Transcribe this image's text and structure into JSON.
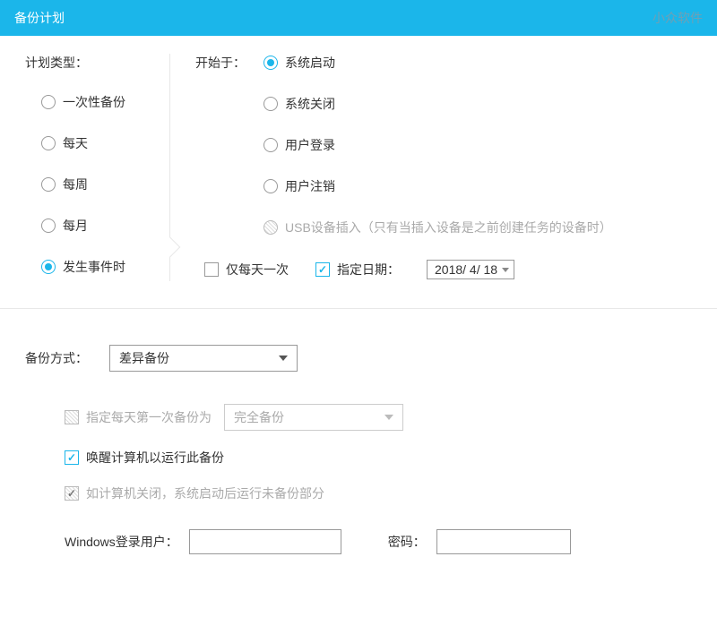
{
  "titlebar": {
    "title": "备份计划",
    "brand": "小众软件"
  },
  "planType": {
    "label": "计划类型：",
    "options": {
      "once": "一次性备份",
      "daily": "每天",
      "weekly": "每周",
      "monthly": "每月",
      "onEvent": "发生事件时"
    },
    "selected": "onEvent"
  },
  "startAt": {
    "label": "开始于：",
    "triggers": {
      "systemStart": "系统启动",
      "systemShutdown": "系统关闭",
      "userLogin": "用户登录",
      "userLogout": "用户注销",
      "usbInsert": "USB设备插入（只有当插入设备是之前创建任务的设备时）"
    },
    "selected": "systemStart"
  },
  "onceDaily": {
    "label": "仅每天一次",
    "checked": false
  },
  "specifyDate": {
    "label": "指定日期：",
    "checked": true,
    "value": "2018/ 4/ 18"
  },
  "backupMode": {
    "label": "备份方式：",
    "value": "差异备份"
  },
  "firstDaily": {
    "label": "指定每天第一次备份为",
    "checked": false,
    "value": "完全备份"
  },
  "wake": {
    "label": "唤醒计算机以运行此备份",
    "checked": true
  },
  "resume": {
    "label": "如计算机关闭，系统启动后运行未备份部分",
    "checked": true
  },
  "creds": {
    "userLabel": "Windows登录用户：",
    "user": "",
    "passLabel": "密码：",
    "pass": ""
  }
}
